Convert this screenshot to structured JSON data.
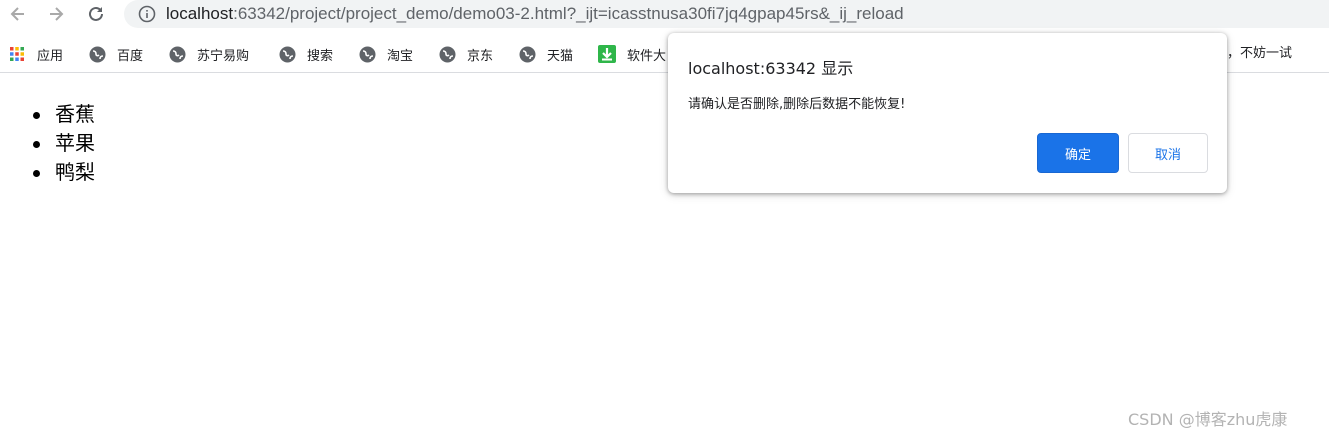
{
  "browser": {
    "url_host": "localhost",
    "url_rest": ":63342/project/project_demo/demo03-2.html?_ijt=icasstnusa30fi7jq4gpap45rs&_ij_reload",
    "bookmarks": [
      {
        "label": "应用",
        "icon": "apps-grid-icon"
      },
      {
        "label": "百度",
        "icon": "globe-icon"
      },
      {
        "label": "苏宁易购",
        "icon": "globe-icon"
      },
      {
        "label": "搜索",
        "icon": "globe-icon"
      },
      {
        "label": "淘宝",
        "icon": "globe-icon"
      },
      {
        "label": "京东",
        "icon": "globe-icon"
      },
      {
        "label": "天猫",
        "icon": "globe-icon"
      },
      {
        "label": "软件大",
        "icon": "download-icon"
      }
    ],
    "bookmark_overflow_text": "豆，不妨一试"
  },
  "page": {
    "list_items": [
      "香蕉",
      "苹果",
      "鸭梨"
    ]
  },
  "dialog": {
    "title": "localhost:63342 显示",
    "message": "请确认是否删除,删除后数据不能恢复!",
    "ok_label": "确定",
    "cancel_label": "取消"
  },
  "watermark": "CSDN @博客zhu虎康",
  "colors": {
    "accent": "#1a73e8",
    "omnibox_bg": "#f1f3f4"
  }
}
